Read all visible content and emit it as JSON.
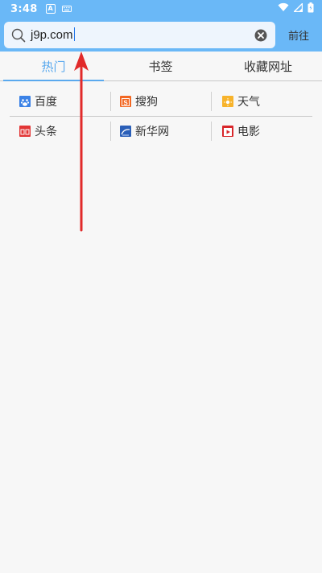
{
  "status_bar": {
    "time": "3:48",
    "left_icons": [
      "a-box-icon",
      "keyboard-icon"
    ],
    "right_icons": [
      "wifi-icon",
      "signal-icon",
      "battery-icon"
    ]
  },
  "header": {
    "search_value": "j9p.com",
    "go_label": "前往"
  },
  "tabs": [
    {
      "label": "热门",
      "active": true
    },
    {
      "label": "书签",
      "active": false
    },
    {
      "label": "收藏网址",
      "active": false
    }
  ],
  "hot_sites": [
    [
      {
        "label": "百度",
        "icon": "baidu-icon",
        "color": "#3b82e6"
      },
      {
        "label": "搜狗",
        "icon": "sogou-icon",
        "color": "#f26722"
      },
      {
        "label": "天气",
        "icon": "weather-icon",
        "color": "#f7b32b"
      }
    ],
    [
      {
        "label": "头条",
        "icon": "toutiao-icon",
        "color": "#e23535"
      },
      {
        "label": "新华网",
        "icon": "xinhua-icon",
        "color": "#2b5fb8"
      },
      {
        "label": "电影",
        "icon": "movie-icon",
        "color": "#d8262a"
      }
    ]
  ],
  "colors": {
    "header_bg": "#6ab8f7",
    "accent": "#5aa9ee",
    "arrow": "#e12a2a"
  }
}
